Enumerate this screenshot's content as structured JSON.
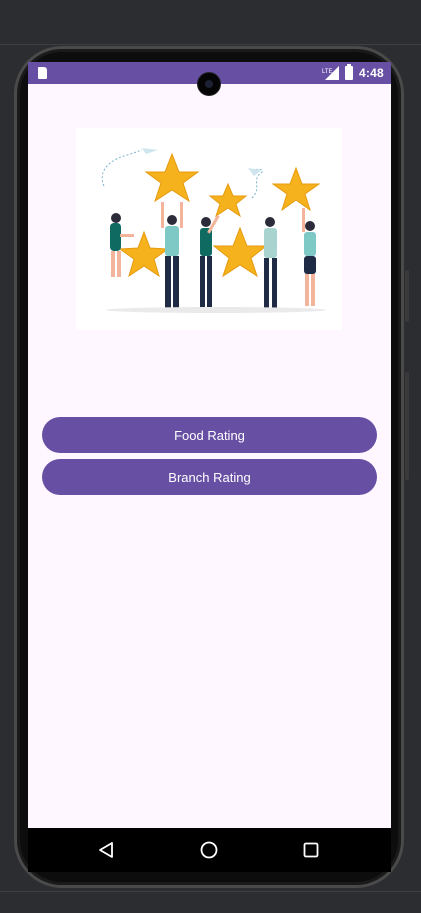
{
  "status_bar": {
    "time": "4:48",
    "sd_card_icon": "sd-card-icon",
    "signal_icon": "signal-icon",
    "battery_icon": "battery-icon"
  },
  "hero_image": {
    "icon": "rating-stars-people-illustration"
  },
  "buttons": {
    "food_rating": "Food Rating",
    "branch_rating": "Branch Rating"
  },
  "nav_bar": {
    "back_icon": "back-triangle-icon",
    "home_icon": "home-circle-icon",
    "recents_icon": "recents-square-icon"
  },
  "colors": {
    "primary": "#6750a4",
    "screen_bg": "#fef7ff",
    "star": "#f6b21c",
    "ide_bg": "#2b2d30"
  }
}
